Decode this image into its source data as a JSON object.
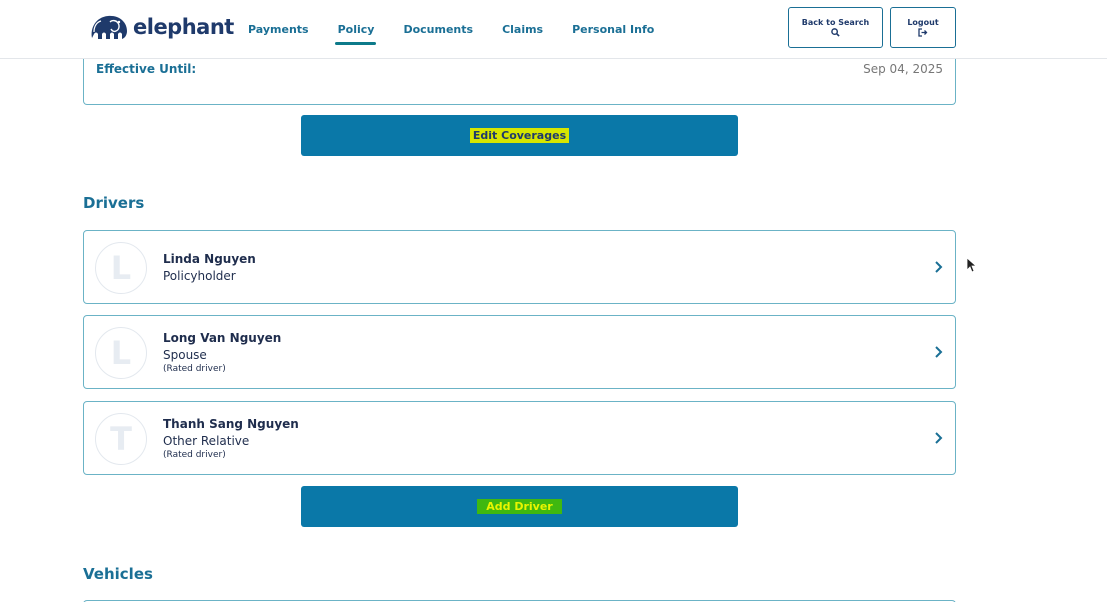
{
  "header": {
    "brand": "elephant",
    "nav": [
      {
        "label": "Payments",
        "active": false
      },
      {
        "label": "Policy",
        "active": true
      },
      {
        "label": "Documents",
        "active": false
      },
      {
        "label": "Claims",
        "active": false
      },
      {
        "label": "Personal Info",
        "active": false
      }
    ],
    "back_to_search_label": "Back to Search",
    "back_to_search_icon": "search-icon",
    "logout_label": "Logout",
    "logout_icon": "sign-out-icon"
  },
  "policy_summary": {
    "effective_until_label": "Effective Until:",
    "effective_until_value": "Sep 04, 2025"
  },
  "edit_coverages_label": "Edit Coverages",
  "drivers": {
    "title": "Drivers",
    "items": [
      {
        "initial": "L",
        "name": "Linda Nguyen",
        "role": "Policyholder",
        "note": ""
      },
      {
        "initial": "L",
        "name": "Long Van Nguyen",
        "role": "Spouse",
        "note": "(Rated driver)"
      },
      {
        "initial": "T",
        "name": "Thanh Sang Nguyen",
        "role": "Other Relative",
        "note": "(Rated driver)"
      }
    ],
    "add_label": "Add Driver"
  },
  "vehicles": {
    "title": "Vehicles"
  },
  "colors": {
    "brand_navy": "#1f3a6b",
    "accent_teal": "#1a6f95",
    "primary_button": "#0a78a8",
    "highlight_yellow": "#d7e600",
    "highlight_green": "#3fb810"
  }
}
